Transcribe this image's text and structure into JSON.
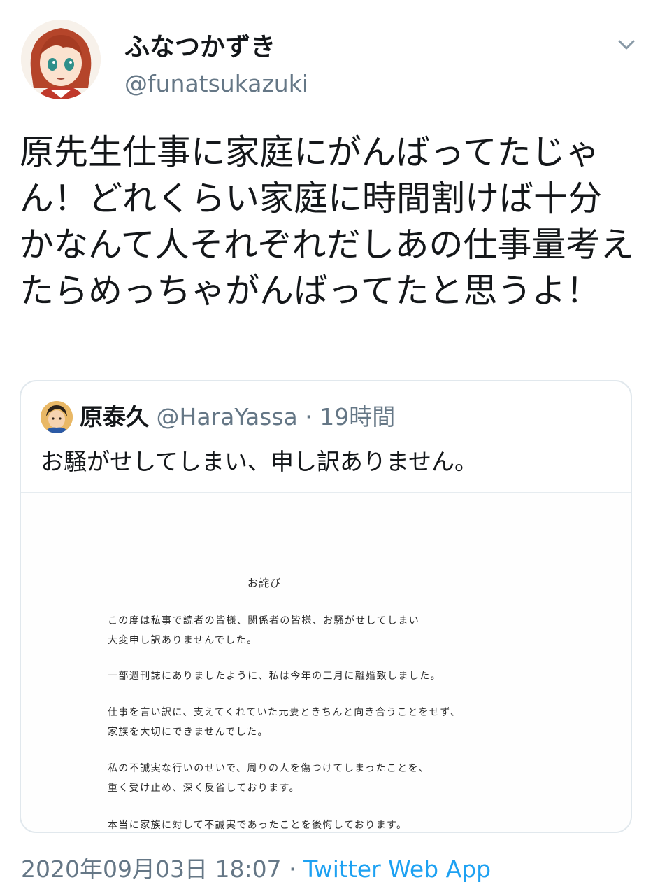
{
  "author": {
    "display_name": "ふなつかずき",
    "handle": "@funatsukazuki"
  },
  "tweet": {
    "text": "原先生仕事に家庭にがんばってたじゃん！どれくらい家庭に時間割けば十分かなんて人それぞれだしあの仕事量考えたらめっちゃがんばってたと思うよ！"
  },
  "quote": {
    "name": "原泰久",
    "handle": "@HaraYassa",
    "separator": "·",
    "time": "19時間",
    "text": "お騒がせしてしまい、申し訳ありません。",
    "document": {
      "title": "お詫び",
      "lines": [
        "この度は私事で読者の皆様、関係者の皆様、お騒がせしてしまい",
        "大変申し訳ありませんでした。",
        "一部週刊誌にありましたように、私は今年の三月に離婚致しました。",
        "仕事を言い訳に、支えてくれていた元妻ときちんと向き合うことをせず、",
        "家族を大切にできませんでした。",
        "私の不誠実な行いのせいで、周りの人を傷つけてしまったことを、",
        "重く受け止め、深く反省しております。",
        "本当に家族に対して不誠実であったことを後悔しております。"
      ]
    }
  },
  "footer": {
    "date": "2020年09月03日 18:07",
    "separator": "·",
    "source": "Twitter Web App"
  },
  "icons": {
    "caret": "chevron-down-icon"
  },
  "colors": {
    "link": "#1da1f2",
    "secondary_text": "#657786",
    "border": "#e1e8ed"
  }
}
